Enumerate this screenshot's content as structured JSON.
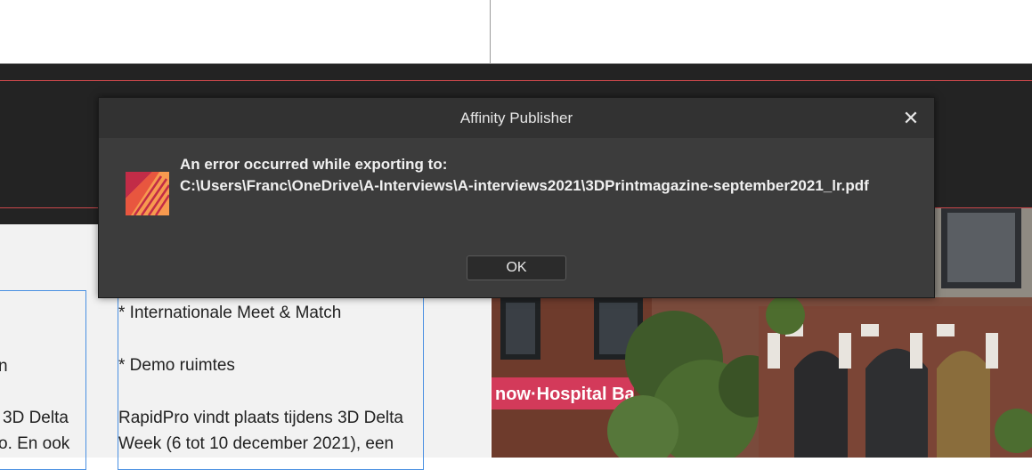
{
  "dialog": {
    "title": "Affinity Publisher",
    "close_icon": "close-icon",
    "message_line1": "An error occurred while exporting to:",
    "message_line2": "C:\\Users\\Franc\\OneDrive\\A-Interviews\\A-interviews2021\\3DPrintmagazine-september2021_lr.pdf",
    "ok_label": "OK",
    "app_icon": "affinity-publisher-icon"
  },
  "document": {
    "left_column_fragments": [
      "n",
      "3D Delta",
      "o. En ook"
    ],
    "right_column_lines": [
      "* Internationale Meet & Match",
      "* Demo ruimtes",
      "RapidPro vindt plaats tijdens 3D Delta",
      "Week (6 tot 10 december 2021), een"
    ],
    "photo_sign_text": "now·Hospital Ba"
  },
  "colors": {
    "dialog_bg": "#3c3c3c",
    "banner_bg": "#232323",
    "frame_border": "#4a90e2",
    "accent_red": "#c9474b"
  }
}
